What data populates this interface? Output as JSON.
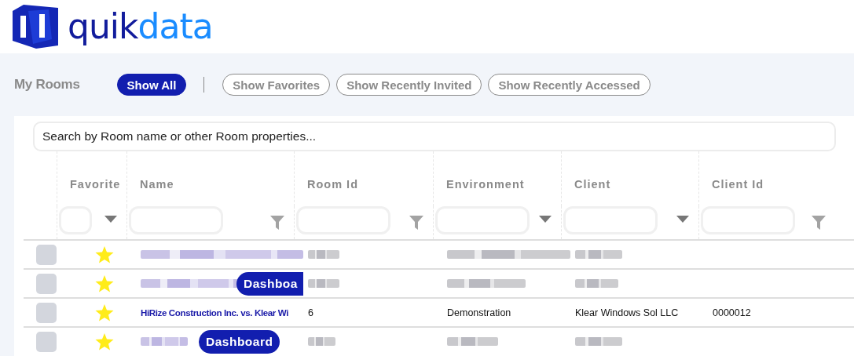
{
  "logo": {
    "text_1": "quik",
    "text_2": "data"
  },
  "toolbar": {
    "title": "My Rooms",
    "filters": [
      {
        "label": "Show All",
        "selected": true
      },
      {
        "label": "Show Favorites",
        "selected": false
      },
      {
        "label": "Show Recently Invited",
        "selected": false
      },
      {
        "label": "Show Recently Accessed",
        "selected": false
      }
    ]
  },
  "search": {
    "placeholder": "Search by Room name or other Room properties..."
  },
  "table": {
    "columns": [
      {
        "label": "Favorite",
        "kind": "select"
      },
      {
        "label": "Name",
        "kind": "text"
      },
      {
        "label": "Room Id",
        "kind": "text"
      },
      {
        "label": "Environment",
        "kind": "select"
      },
      {
        "label": "Client",
        "kind": "select"
      },
      {
        "label": "Client Id",
        "kind": "text"
      }
    ],
    "rows": [
      {
        "kind": "redacted",
        "checked": false,
        "favorite": true
      },
      {
        "kind": "redacted",
        "checked": false,
        "favorite": true,
        "badge": "Dashboa"
      },
      {
        "kind": "visible",
        "checked": false,
        "favorite": true,
        "name": "HiRize Construction Inc. vs. Klear Wi",
        "room_id": "6",
        "environment": "Demonstration",
        "client": "Klear Windows Sol LLC",
        "client_id": "0000012"
      },
      {
        "kind": "redacted",
        "checked": false,
        "favorite": true,
        "badge": "Dashboard"
      }
    ]
  }
}
